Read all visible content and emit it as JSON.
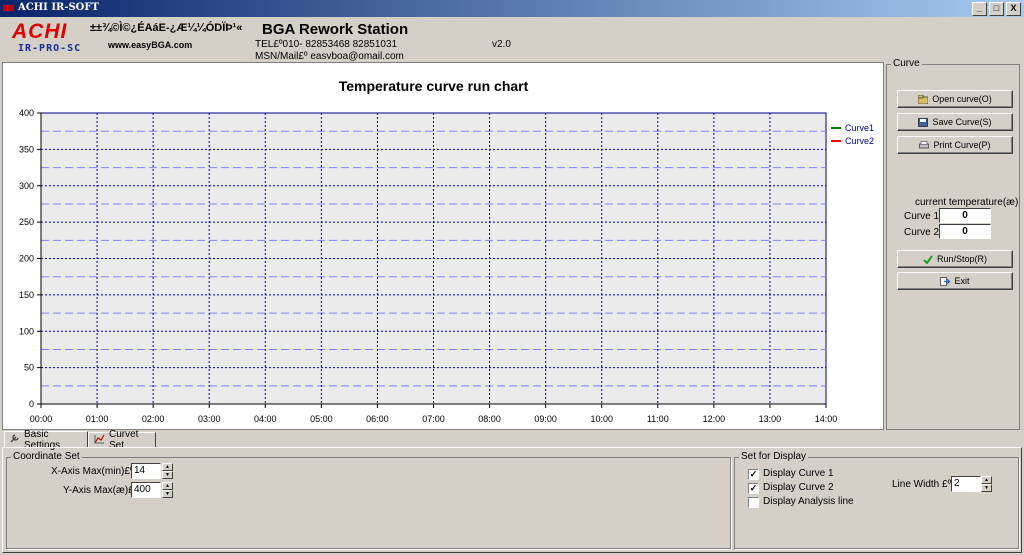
{
  "window": {
    "title": "ACHI IR-SOFT",
    "controls": [
      "_",
      "□",
      "X"
    ]
  },
  "header": {
    "logo": "ACHI",
    "logo_sub": "IR-PRO-SC",
    "garbled_title": "±±¾©Ì©¿ÉAáE-¿Æ¼¼ÓDÏÞ¹«",
    "website": "www.easyBGA.com",
    "title": "BGA Rework Station",
    "tel": "TEL£º010- 82853468  82851031",
    "mail": "MSN/Mail£º easvboa@omail.com",
    "version": "v2.0"
  },
  "chart_data": {
    "type": "line",
    "title": "Temperature curve run chart",
    "x_ticks": [
      "00:00",
      "01:00",
      "02:00",
      "03:00",
      "04:00",
      "05:00",
      "06:00",
      "07:00",
      "08:00",
      "09:00",
      "10:00",
      "11:00",
      "12:00",
      "13:00",
      "14:00"
    ],
    "y_ticks": [
      0,
      50,
      100,
      150,
      200,
      250,
      300,
      350,
      400
    ],
    "xlim": [
      0,
      14
    ],
    "ylim": [
      0,
      400
    ],
    "grid": true,
    "legend_position": "top-right",
    "series": [
      {
        "name": "Curve1",
        "color": "#008000",
        "values": []
      },
      {
        "name": "Curve2",
        "color": "#ff0000",
        "values": []
      }
    ]
  },
  "curve_group": {
    "title": "Curve",
    "open_label": "Open curve(O)",
    "save_label": "Save Curve(S)",
    "print_label": "Print Curve(P)",
    "current_temp_label": "current temperature(æ)",
    "curve1_label": "Curve 1",
    "curve1_value": "0",
    "curve2_label": "Curve 2",
    "curve2_value": "0",
    "run_label": "Run/Stop(R)",
    "exit_label": "Exit"
  },
  "tabs": [
    {
      "label": "Basic Settings",
      "icon": "wrench-icon"
    },
    {
      "label": "Curvet Set",
      "icon": "chart-icon"
    }
  ],
  "coordinate_set": {
    "title": "Coordinate Set",
    "x_label": "X-Axis Max(min)£º",
    "x_value": "14",
    "y_label": "Y-Axis Max(æ)£º",
    "y_value": "400"
  },
  "display_set": {
    "title": "Set for Display",
    "curve1_label": "Display Curve 1",
    "curve1_checked": true,
    "curve2_label": "Display Curve 2",
    "curve2_checked": true,
    "analysis_label": "Display Analysis line",
    "analysis_checked": false,
    "line_width_label": "Line Width £º",
    "line_width_value": "2"
  }
}
